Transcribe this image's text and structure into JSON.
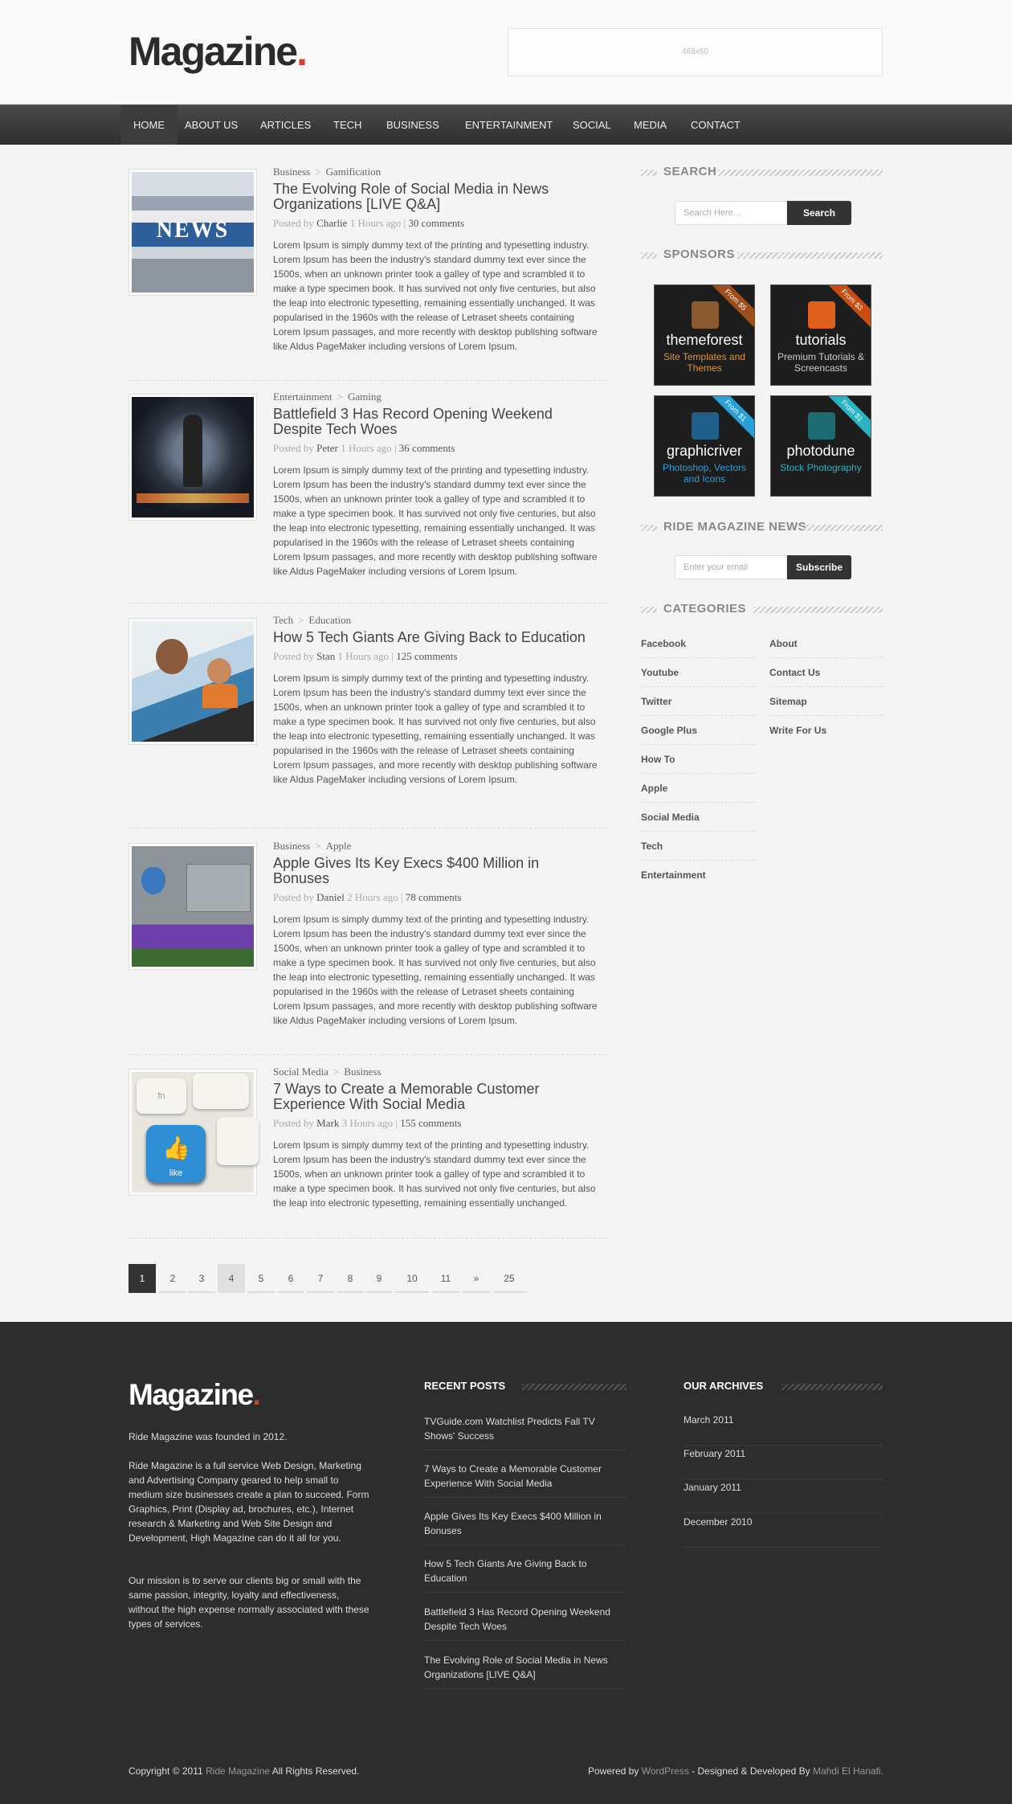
{
  "header": {
    "logo_text": "Magazine",
    "logo_dot": ".",
    "ad_label": "468x60"
  },
  "nav": {
    "items": [
      "HOME",
      "ABOUT US",
      "ARTICLES",
      "TECH",
      "BUSINESS",
      "ENTERTAINMENT",
      "SOCIAL",
      "MEDIA",
      "CONTACT"
    ]
  },
  "posts": [
    {
      "cat1": "Business",
      "cat2": "Gamification",
      "sep": ">",
      "title": "The Evolving Role of Social Media in News Organizations [LIVE Q&A]",
      "posted_by": "Posted by",
      "author": "Charlie",
      "time": "1 Hours ago",
      "comments": "30 comments",
      "excerpt": "Lorem Ipsum is simply dummy text of the printing and typesetting industry. Lorem Ipsum has been the industry's standard dummy text ever since the 1500s, when an unknown printer took a galley of type and scrambled it to make a type specimen book. It has survived not only five centuries, but also the leap into electronic typesetting, remaining essentially unchanged. It was popularised in the 1960s with the release of Letraset sheets containing Lorem Ipsum passages, and more recently with desktop publishing software like Aldus PageMaker including versions of Lorem Ipsum.",
      "thumb_label": "NEWS"
    },
    {
      "cat1": "Entertainment",
      "cat2": "Gaming",
      "sep": ">",
      "title": "Battlefield 3 Has Record Opening Weekend Despite Tech Woes",
      "posted_by": "Posted by",
      "author": "Peter",
      "time": "1 Hours ago",
      "comments": "36 comments",
      "excerpt": "Lorem Ipsum is simply dummy text of the printing and typesetting industry. Lorem Ipsum has been the industry's standard dummy text ever since the 1500s, when an unknown printer took a galley of type and scrambled it to make a type specimen book. It has survived not only five centuries, but also the leap into electronic typesetting, remaining essentially unchanged. It was popularised in the 1960s with the release of Letraset sheets containing Lorem Ipsum passages, and more recently with desktop publishing software like Aldus PageMaker including versions of Lorem Ipsum."
    },
    {
      "cat1": "Tech",
      "cat2": "Education",
      "sep": ">",
      "title": "How 5 Tech Giants Are Giving Back to Education",
      "posted_by": "Posted by",
      "author": "Stan",
      "time": "1 Hours ago",
      "comments": "125 comments",
      "excerpt": "Lorem Ipsum is simply dummy text of the printing and typesetting industry. Lorem Ipsum has been the industry's standard dummy text ever since the 1500s, when an unknown printer took a galley of type and scrambled it to make a type specimen book. It has survived not only five centuries, but also the leap into electronic typesetting, remaining essentially unchanged. It was popularised in the 1960s with the release of Letraset sheets containing Lorem Ipsum passages, and more recently with desktop publishing software like Aldus PageMaker including versions of Lorem Ipsum."
    },
    {
      "cat1": "Business",
      "cat2": "Apple",
      "sep": ">",
      "title": "Apple Gives Its Key Execs $400 Million in Bonuses",
      "posted_by": "Posted by",
      "author": "Daniel",
      "time": "2 Hours ago",
      "comments": "78 comments",
      "excerpt": "Lorem Ipsum is simply dummy text of the printing and typesetting industry. Lorem Ipsum has been the industry's standard dummy text ever since the 1500s, when an unknown printer took a galley of type and scrambled it to make a type specimen book. It has survived not only five centuries, but also the leap into electronic typesetting, remaining essentially unchanged. It was popularised in the 1960s with the release of Letraset sheets containing Lorem Ipsum passages, and more recently with desktop publishing software like Aldus PageMaker including versions of Lorem Ipsum."
    },
    {
      "cat1": "Social Media",
      "cat2": "Business",
      "sep": ">",
      "title": "7 Ways to Create a Memorable Customer Experience With Social Media",
      "posted_by": "Posted by",
      "author": "Mark",
      "time": "3 Hours ago",
      "comments": "155 comments",
      "excerpt": "Lorem Ipsum is simply dummy text of the printing and typesetting industry. Lorem Ipsum has been the industry's standard dummy text ever since the 1500s, when an unknown printer took a galley of type and scrambled it to make a type specimen book. It has survived not only five centuries, but also the leap into electronic typesetting, remaining essentially unchanged.",
      "thumb_label": "like",
      "thumb_key": "fn"
    }
  ],
  "pagination": {
    "pages": [
      "1",
      "2",
      "3",
      "4",
      "5",
      "6",
      "7",
      "8",
      "9",
      "10",
      "11",
      "»",
      "25"
    ],
    "current": "1",
    "highlighted": "4"
  },
  "sidebar": {
    "search_heading": "SEARCH",
    "search_placeholder": "Search Here...",
    "search_button": "Search",
    "sponsors_heading": "SPONSORS",
    "sponsors": [
      {
        "name": "themeforest",
        "sub": "Site Templates and Themes",
        "ribbon": "From $5",
        "color": "#e0913a"
      },
      {
        "name": "tutorials",
        "sub": "Premium Tutorials & Screencasts",
        "ribbon": "From $3",
        "color": "#e0601e"
      },
      {
        "name": "graphicriver",
        "sub": "Photoshop, Vectors and Icons",
        "ribbon": "From $1",
        "color": "#2a9fd8"
      },
      {
        "name": "photodune",
        "sub": "Stock Photography",
        "ribbon": "From $1",
        "color": "#27b5c4"
      }
    ],
    "news_heading": "RIDE MAGAZINE NEWS",
    "news_placeholder": "Enter your email",
    "news_button": "Subscribe",
    "categories_heading": "CATEGORIES",
    "categories_left": [
      "Facebook",
      "Youtube",
      "Twitter",
      "Google Plus",
      "How To",
      "Apple",
      "Social Media",
      "Tech",
      "Entertainment"
    ],
    "categories_right": [
      "About",
      "Contact Us",
      "Sitemap",
      "Write For Us"
    ]
  },
  "footer": {
    "logo_text": "Magazine",
    "logo_dot": ".",
    "founded": "Ride Magazine was founded in 2012.",
    "about": "Ride Magazine is a full service Web Design, Marketing and Advertising Company geared to help small to medium size businesses create a plan to succeed. Form Graphics, Print (Display ad, brochures, etc.), Internet research & Marketing and Web Site Design and Development, High Magazine can do it all for you.",
    "mission": "Our mission is to serve our clients big or small with the same passion, integrity, loyalty and effectiveness, without the high expense normally associated with these types of services.",
    "recent_heading": "RECENT POSTS",
    "recent_posts": [
      "TVGuide.com Watchlist Predicts Fall TV Shows' Success",
      "7 Ways to Create a Memorable Customer Experience With Social Media",
      "Apple Gives Its Key Execs $400 Million in Bonuses",
      "How 5 Tech Giants Are Giving Back to Education",
      "Battlefield 3 Has Record Opening Weekend Despite Tech Woes",
      "The Evolving Role of Social Media in News Organizations [LIVE Q&A]"
    ],
    "archives_heading": "OUR ARCHIVES",
    "archives": [
      "March 2011",
      "February 2011",
      "January 2011",
      "December 2010"
    ],
    "copyright_pre": "Copyright © 2011",
    "copyright_link": "Ride Magazine",
    "copyright_post": "All Rights Reserved.",
    "powered_pre": "Powered by",
    "powered_link": "WordPress",
    "powered_mid": "- Designed & Developed By",
    "powered_author": "Mahdi El Hanafi."
  },
  "colors": {
    "accent": "#d6402a",
    "nav_bg": "#3a3a3a",
    "footer_bg": "#2d2d2d"
  }
}
